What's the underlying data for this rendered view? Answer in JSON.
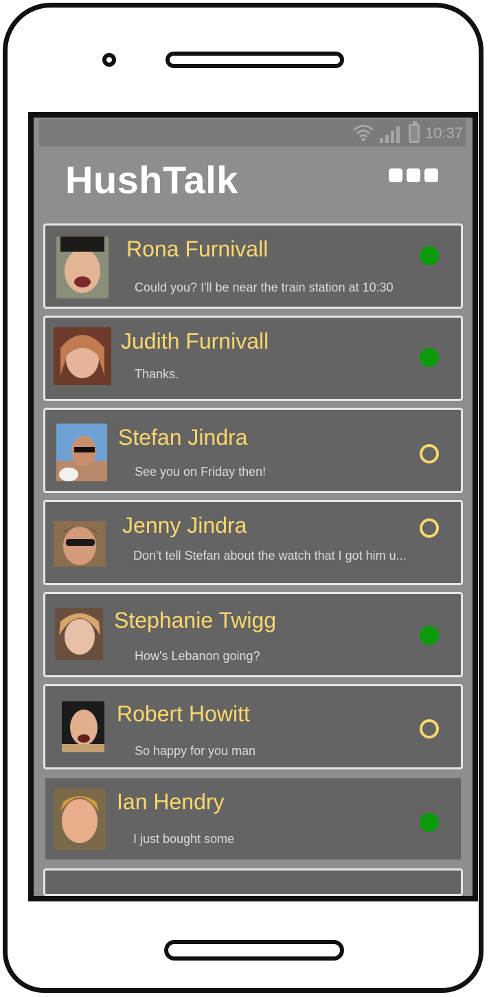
{
  "status_bar": {
    "time": "10:37"
  },
  "app": {
    "title": "HushTalk"
  },
  "contacts": [
    {
      "name": "Rona Furnivall",
      "message": "Could you? I'll be near the train station at 10:30",
      "status": "online"
    },
    {
      "name": "Judith Furnivall",
      "message": "Thanks.",
      "status": "online"
    },
    {
      "name": "Stefan Jindra",
      "message": "See you on Friday then!",
      "status": "offline"
    },
    {
      "name": "Jenny Jindra",
      "message": "Don't tell Stefan about the watch that I got him u...",
      "status": "offline"
    },
    {
      "name": "Stephanie Twigg",
      "message": "How's Lebanon going?",
      "status": "online"
    },
    {
      "name": "Robert Howitt",
      "message": "So happy for you man",
      "status": "offline"
    },
    {
      "name": "Ian Hendry",
      "message": "I just bought some",
      "status": "online"
    }
  ],
  "colors": {
    "name": "#fcd86b",
    "online": "#0a9a0a",
    "offline": "#fcd86b",
    "card": "#646464",
    "background": "#8e8e8e"
  },
  "icons": {
    "wifi": "wifi-icon",
    "signal": "signal-icon",
    "battery": "battery-icon",
    "menu": "more-icon"
  }
}
